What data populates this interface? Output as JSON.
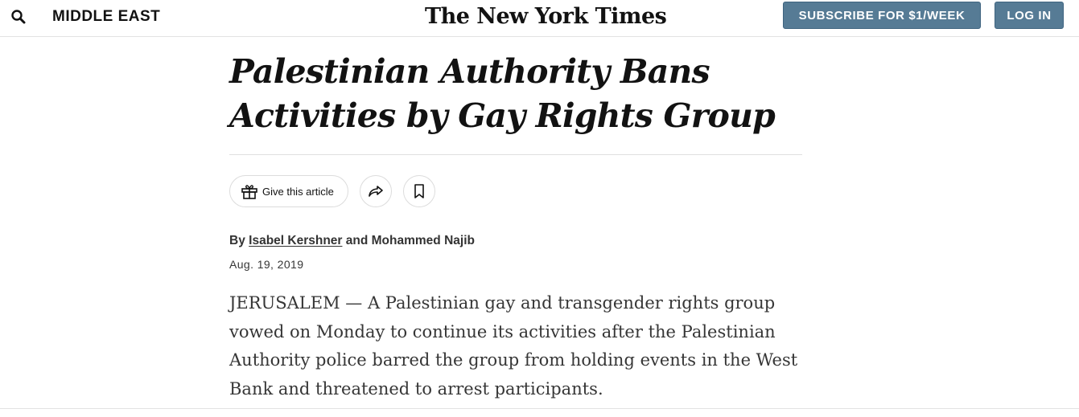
{
  "header": {
    "section": "MIDDLE EAST",
    "logo": "The New York Times",
    "subscribe_label": "SUBSCRIBE FOR $1/WEEK",
    "login_label": "LOG IN",
    "button_color": "#567b95"
  },
  "article": {
    "headline": "Palestinian Authority Bans Activities by Gay Rights Group",
    "tools": {
      "give_label": "Give this article",
      "give_icon": "gift-icon",
      "share_icon": "share-icon",
      "save_icon": "bookmark-icon"
    },
    "byline": {
      "prefix": "By",
      "author1": "Isabel Kershner",
      "conjunction": "and",
      "author2": "Mohammed Najib"
    },
    "date": "Aug. 19, 2019",
    "lede": "JERUSALEM — A Palestinian gay and transgender rights group vowed on Monday to continue its activities after the Palestinian Authority police barred the group from holding events in the West Bank and threatened to arrest participants."
  }
}
